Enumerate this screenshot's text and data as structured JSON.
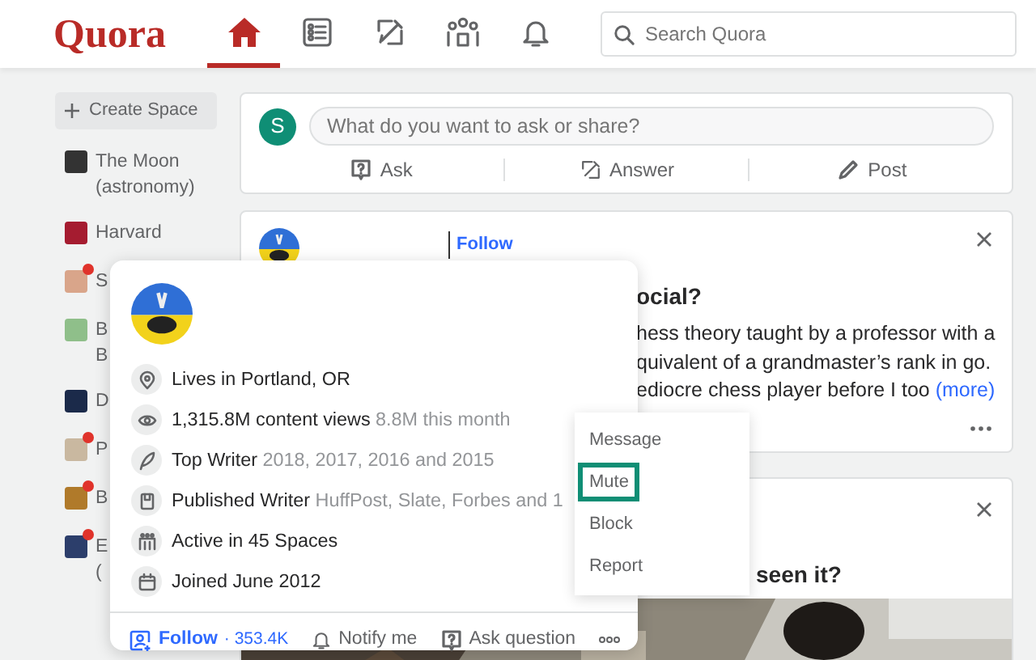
{
  "header": {
    "logo": "Quora",
    "nav": [
      {
        "selected": true
      },
      {
        "selected": false
      },
      {
        "selected": false
      },
      {
        "selected": false
      },
      {
        "selected": false
      }
    ],
    "search": {
      "placeholder": "Search Quora"
    }
  },
  "sidebar": {
    "create_button": "Create Space",
    "items": [
      {
        "lines": [
          "The Moon",
          "(astronomy)"
        ],
        "color": "#333333",
        "unread": false
      },
      {
        "lines": [
          "Harvard"
        ],
        "color": "#a51c30",
        "unread": false
      },
      {
        "lines": [
          "S"
        ],
        "color": "#d9a58a",
        "unread": true
      },
      {
        "lines": [
          "B",
          "B"
        ],
        "color": "#8fbf8a",
        "unread": false
      },
      {
        "lines": [
          "D"
        ],
        "color": "#1b2a4a",
        "unread": false
      },
      {
        "lines": [
          "P"
        ],
        "color": "#c9b8a0",
        "unread": true
      },
      {
        "lines": [
          "B"
        ],
        "color": "#b07a2a",
        "unread": true
      },
      {
        "lines": [
          "E",
          "("
        ],
        "color": "#2c3e6b",
        "unread": true
      }
    ]
  },
  "ask_box": {
    "avatar": "S",
    "placeholder": "What do you want to ask or share?",
    "actions": [
      "Ask",
      "Answer",
      "Post"
    ]
  },
  "posts": [
    {
      "follow": "Follow",
      "title": "ocial?",
      "body": [
        "hess theory taught by a professor with a",
        "quivalent of a grandmaster’s rank in go.",
        "ediocre chess player before I too"
      ],
      "more": "(more)"
    },
    {
      "title": "seen it?"
    }
  ],
  "profile_card": {
    "details": [
      {
        "text": "Lives in Portland, OR"
      },
      {
        "text": "1,315.8M content views",
        "note": "8.8M this month"
      },
      {
        "text": "Top Writer",
        "note": "2018, 2017, 2016 and 2015"
      },
      {
        "text": "Published Writer",
        "note": "HuffPost, Slate, Forbes and 1"
      },
      {
        "text": "Active in 45 Spaces"
      },
      {
        "text": "Joined June 2012"
      }
    ],
    "follow": "Follow",
    "followers": "· 353.4K",
    "notify": "Notify me",
    "ask": "Ask question"
  },
  "menu": {
    "items": [
      {
        "label": "Message",
        "focused": false
      },
      {
        "label": "Mute",
        "focused": true
      },
      {
        "label": "Block",
        "focused": false
      },
      {
        "label": "Report",
        "focused": false
      }
    ]
  }
}
